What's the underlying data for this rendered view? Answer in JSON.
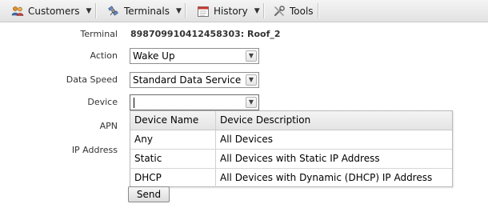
{
  "menubar": {
    "items": [
      {
        "label": "Customers",
        "icon": "users-icon",
        "has_dropdown": true
      },
      {
        "label": "Terminals",
        "icon": "satellite-icon",
        "has_dropdown": true
      },
      {
        "label": "History",
        "icon": "calendar-icon",
        "has_dropdown": true
      },
      {
        "label": "Tools",
        "icon": "tools-icon",
        "has_dropdown": false
      }
    ]
  },
  "form": {
    "terminal_label": "Terminal",
    "terminal_value": "898709910412458303: Roof_2",
    "action_label": "Action",
    "action_value": "Wake Up",
    "data_speed_label": "Data Speed",
    "data_speed_value": "Standard Data Service",
    "device_label": "Device",
    "device_value": "",
    "apn_label": "APN",
    "ip_address_label": "IP Address",
    "send_label": "Send"
  },
  "device_dropdown": {
    "headers": [
      "Device Name",
      "Device Description"
    ],
    "rows": [
      [
        "Any",
        "All Devices"
      ],
      [
        "Static",
        "All Devices with Static IP Address"
      ],
      [
        "DHCP",
        "All Devices with Dynamic (DHCP) IP Address"
      ]
    ]
  },
  "colors": {
    "menubar_bg": "#ebebeb",
    "border": "#8e8e8e",
    "header_bg": "#ececec"
  }
}
